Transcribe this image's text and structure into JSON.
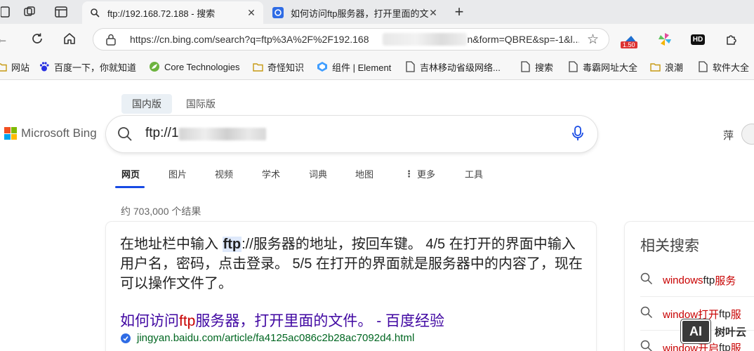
{
  "tabs": [
    {
      "title": "ftp://192.168.72.188 - 搜索",
      "active": true
    },
    {
      "title": "如何访问ftp服务器，打开里面的文",
      "active": false
    }
  ],
  "address_bar": {
    "url": "https://cn.bing.com/search?q=ftp%3A%2F%2F192.168",
    "url_tail": "n&form=QBRE&sp=-1&l...",
    "badge": "1.50",
    "ext_hd": "HD"
  },
  "bookmarks": [
    "网站",
    "百度一下，你就知道",
    "Core Technologies",
    "奇怪知识",
    "组件 | Element",
    "吉林移动省级网络...",
    "搜索",
    "毒霸网址大全",
    "浪潮",
    "软件大全"
  ],
  "bing": {
    "region_tabs": [
      "国内版",
      "国际版"
    ],
    "brand": "Microsoft Bing",
    "query": "ftp://1",
    "user_name": "萍",
    "scopes": [
      "网页",
      "图片",
      "视频",
      "学术",
      "词典",
      "地图",
      "更多",
      "工具"
    ],
    "result_count": "约 703,000 个结果"
  },
  "answer": {
    "pre": "在地址栏中输入 ",
    "hl": "ftp",
    "post": "://服务器的地址，按回车键。 4/5 在打开的界面中输入 用户名，密码，点击登录。 5/5 在打开的界面就是服务器中的内容了，现在可以操作文件了。"
  },
  "result": {
    "title_pre": "如何访问",
    "title_hl": "ftp",
    "title_post": "服务器，打开里面的文件。 - 百度经验",
    "url": "jingyan.baidu.com/article/fa4125ac086c2b28ac7092d4.html"
  },
  "related": {
    "title": "相关搜索",
    "items": [
      {
        "a": "windows ",
        "b": "ftp",
        "c": "服务"
      },
      {
        "a": "window打开",
        "b": "ftp",
        "c": "服"
      },
      {
        "a": "window开启",
        "b": "ftp",
        "c": "服"
      }
    ]
  },
  "watermark": {
    "logo": "AI",
    "text": "树叶云"
  },
  "colors": {
    "accent": "#174ae4",
    "title_link": "#4007a2",
    "highlight": "#c80000",
    "url_green": "#006621"
  }
}
